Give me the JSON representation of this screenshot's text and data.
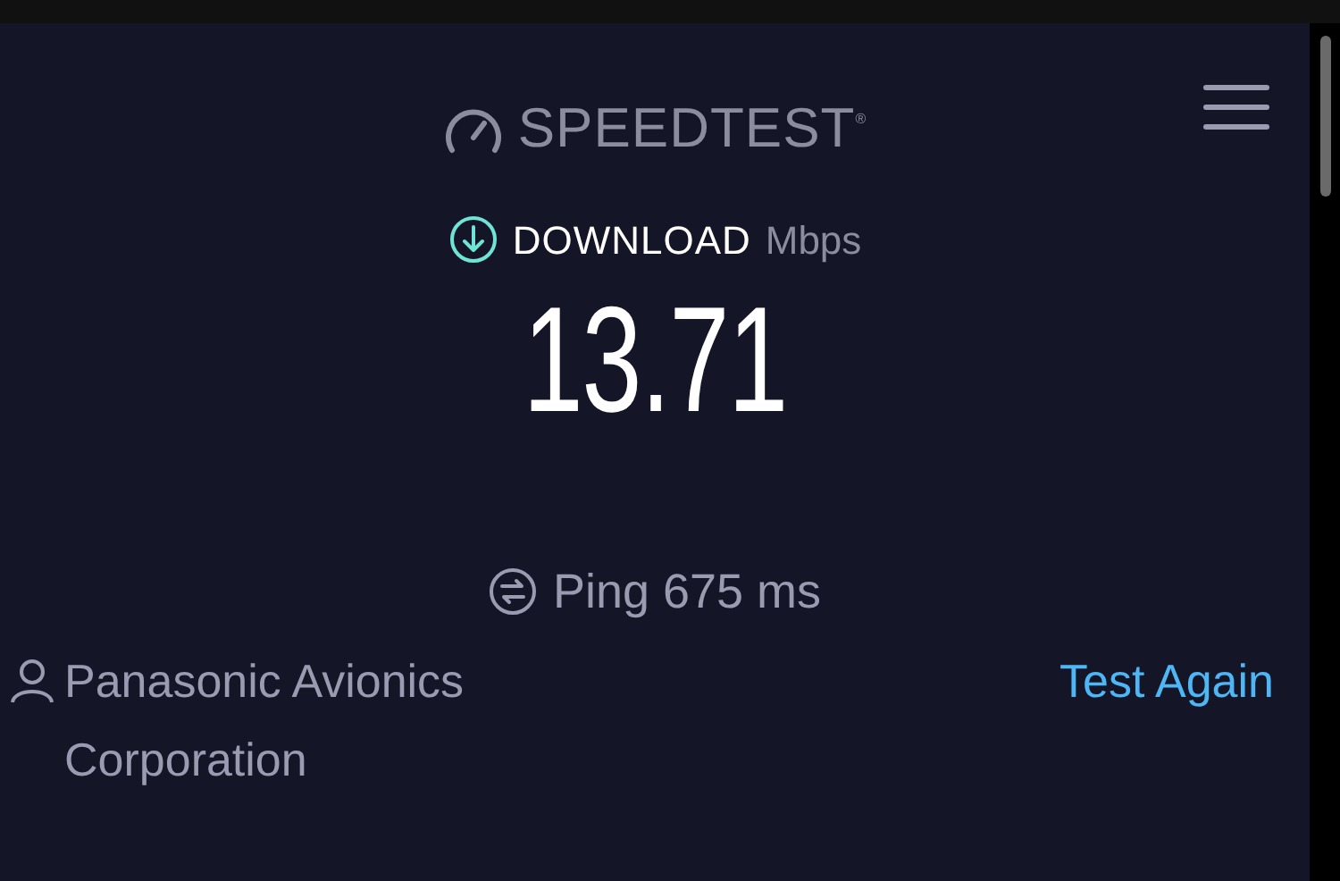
{
  "logo": {
    "text": "SPEEDTEST$^{®}$"
  },
  "result": {
    "label": "DOWNLOAD",
    "unit": "Mbps",
    "value": "13.71"
  },
  "ping": {
    "text": "Ping 675 ms"
  },
  "provider": {
    "name": "Panasonic Avionics Corporation"
  },
  "action": {
    "label": "Test Again"
  }
}
